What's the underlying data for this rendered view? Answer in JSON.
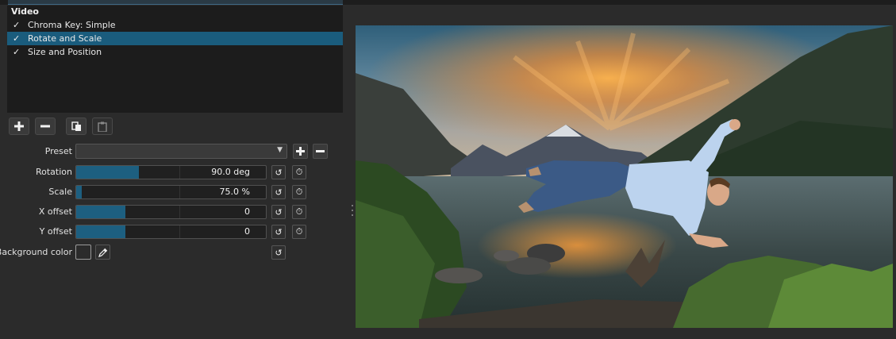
{
  "filters": {
    "header": "Video",
    "items": [
      {
        "label": "Chroma Key: Simple",
        "checked": true,
        "selected": false
      },
      {
        "label": "Rotate and Scale",
        "checked": true,
        "selected": true
      },
      {
        "label": "Size and Position",
        "checked": true,
        "selected": false
      }
    ]
  },
  "toolbar": {
    "add_icon": "plus-icon",
    "remove_icon": "minus-icon",
    "copy_icon": "copy-icon",
    "paste_icon": "paste-icon"
  },
  "params": {
    "preset": {
      "label": "Preset",
      "value": ""
    },
    "rotation": {
      "label": "Rotation",
      "value": "90.0 deg",
      "level": 0.33
    },
    "scale": {
      "label": "Scale",
      "value": "75.0 %",
      "level": 0.03
    },
    "x_offset": {
      "label": "X offset",
      "value": "0",
      "level": 0.26
    },
    "y_offset": {
      "label": "Y offset",
      "value": "0",
      "level": 0.26
    },
    "background_color": {
      "label": "Background color",
      "value": "#2b2b2b"
    }
  },
  "colors": {
    "accent": "#1d5f80",
    "selection": "#1a5c7d",
    "panel_bg": "#2b2b2b"
  }
}
